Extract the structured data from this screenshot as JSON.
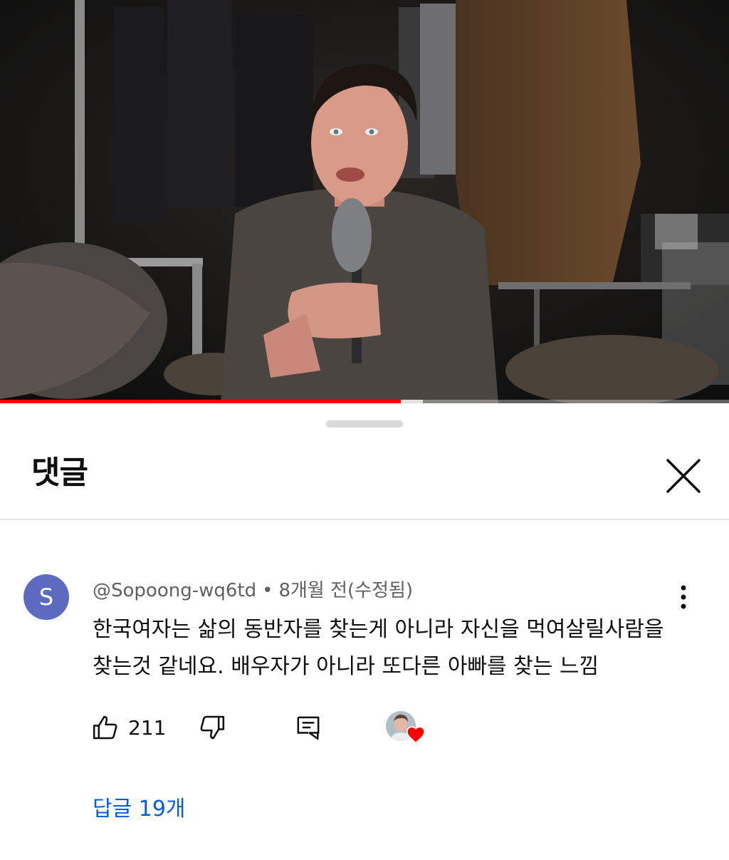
{
  "video": {
    "progress_percent": 55,
    "buffered_percent": 58,
    "progress_color": "#ff0000"
  },
  "comments_panel": {
    "title": "댓글",
    "close_icon": "close-icon"
  },
  "comment": {
    "avatar_letter": "S",
    "avatar_color": "#5c6bc0",
    "author": "@Sopoong-wq6td",
    "separator": "•",
    "time": "8개월 전(수정됨)",
    "text": "한국여자는 삶의 동반자를 찾는게 아니라 자신을 먹여살릴사람을 찾는것 같네요. 배우자가 아니라 또다른 아빠를 찾는 느낌",
    "likes": "211",
    "like_icon": "thumbs-up-icon",
    "dislike_icon": "thumbs-down-icon",
    "reply_icon": "reply-icon",
    "creator_heart_icon": "heart-icon",
    "replies_label": "답글 19개",
    "link_color": "#065fd4"
  }
}
